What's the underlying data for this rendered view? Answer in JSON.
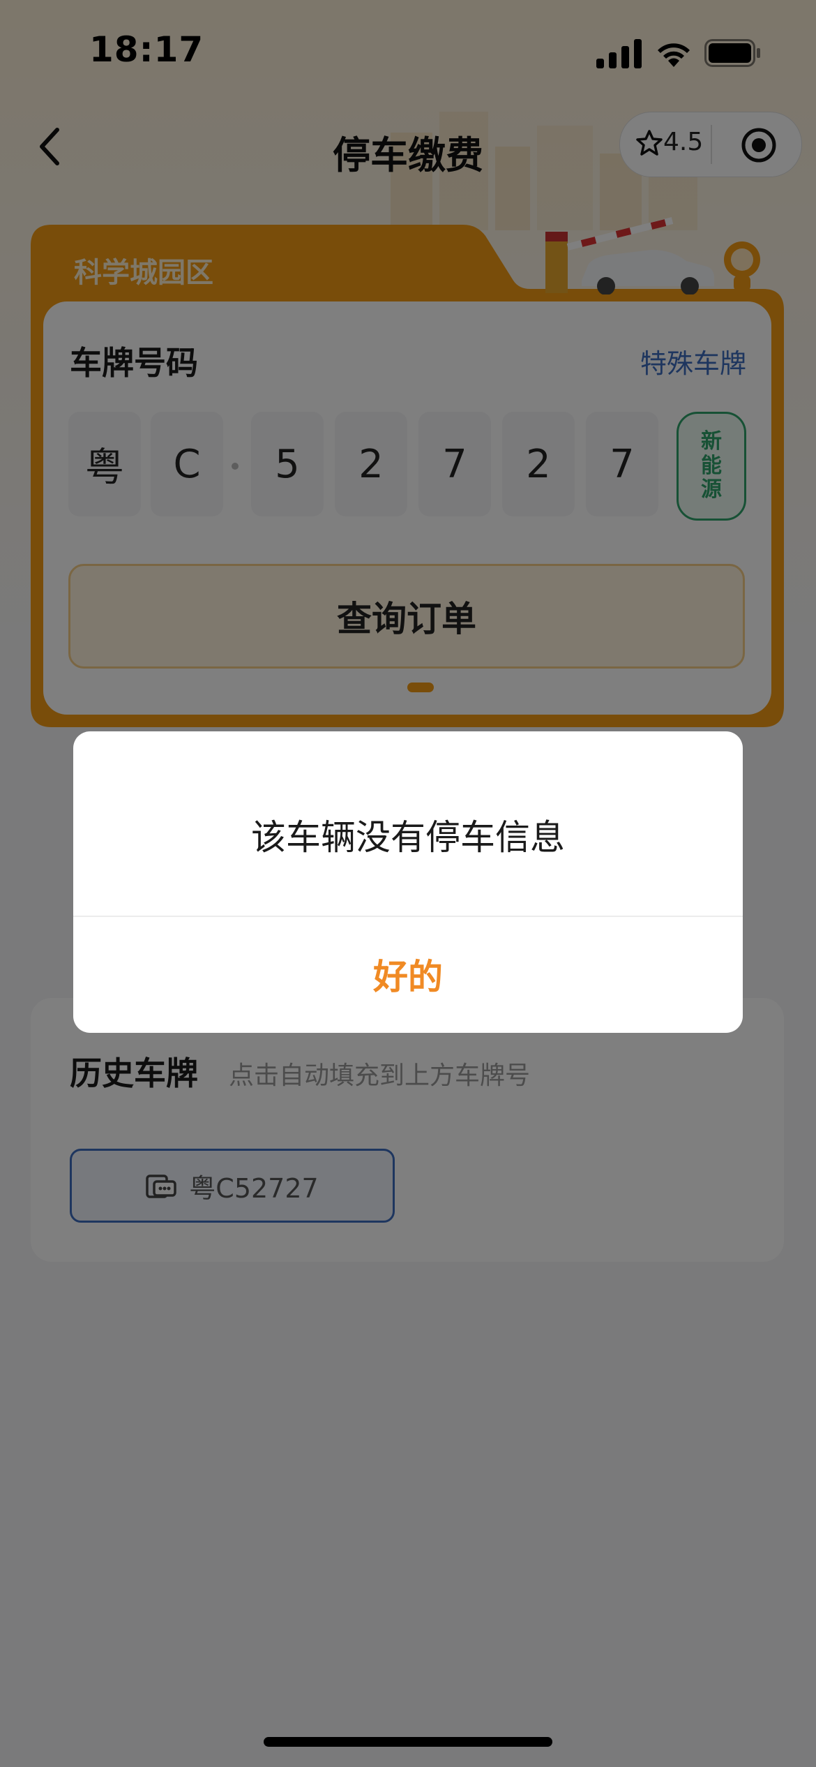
{
  "status_bar": {
    "time": "18:17"
  },
  "nav": {
    "title": "停车缴费",
    "rating": "4.5"
  },
  "card": {
    "park_name": "科学城园区",
    "plate_label": "车牌号码",
    "special_plate": "特殊车牌",
    "plate_chars": [
      "粤",
      "C",
      "5",
      "2",
      "7",
      "2",
      "7"
    ],
    "new_energy": [
      "新",
      "能",
      "源"
    ],
    "query_button": "查询订单"
  },
  "history": {
    "title": "历史车牌",
    "hint": "点击自动填充到上方车牌号",
    "plates": [
      "粤C52727"
    ]
  },
  "dialog": {
    "message": "该车辆没有停车信息",
    "ok": "好的"
  },
  "colors": {
    "accent": "#f39b14",
    "link": "#3c6cbf",
    "green": "#2fa36b",
    "ok": "#f08a24"
  }
}
